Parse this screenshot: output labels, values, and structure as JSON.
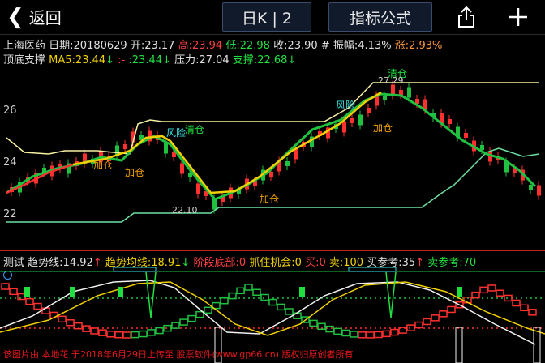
{
  "topbar": {
    "back_label": "返回",
    "period_label": "日K | 2",
    "formula_label": "指标公式"
  },
  "quote": {
    "name": "上海医药",
    "date": "日期:20180629",
    "open": "开:23.17",
    "high": "高:23.94",
    "low": "低:22.98",
    "close": "收:23.90",
    "amp": "# 振幅:4.13%",
    "change": "涨:2.93%"
  },
  "indicator_main": {
    "name": "顶底支撑",
    "ma5": "MA5:23.44",
    "ma5_arrow": "↓",
    "ma_alt": ":23.44",
    "ma_alt_arrow": "↓",
    "pressure": "压力:27.04",
    "support": "支撑:22.68",
    "support_arrow": "↓"
  },
  "price_axis": [
    "26",
    "24",
    "22"
  ],
  "annotations": {
    "clear1": "清仓",
    "clear2": "清仓",
    "risk1": "风险",
    "risk2": "风险",
    "add1": "加仓",
    "add2": "加仓",
    "add3": "加仓",
    "add4": "加仓",
    "high_price": "27.29",
    "low_price": "22.10"
  },
  "sub_indicator": {
    "name": "测试",
    "trend": "趋势线:14.92",
    "trend_arrow": "↑",
    "trend_avg": "趋势均线:18.91",
    "trend_avg_arrow": "↓",
    "stage_bottom": "阶段底部:0",
    "catch": "抓住机会:0",
    "buy": "买:0",
    "sell": "卖:100",
    "buy_ref": "买参考:35",
    "buy_ref_arrow": "↑",
    "sell_ref": "卖参考:70"
  },
  "footer": "该图片由 本地花 于2018年6月29日上传至 股票软件(www.gp66.cn) 版权归原创者所有",
  "colors": {
    "up": "#ff3030",
    "down": "#20c040",
    "ma_yellow": "#f0d000",
    "support_line": "#6de0a0",
    "pressure_line": "#f7f0a0",
    "cyan": "#38e0e0"
  }
}
